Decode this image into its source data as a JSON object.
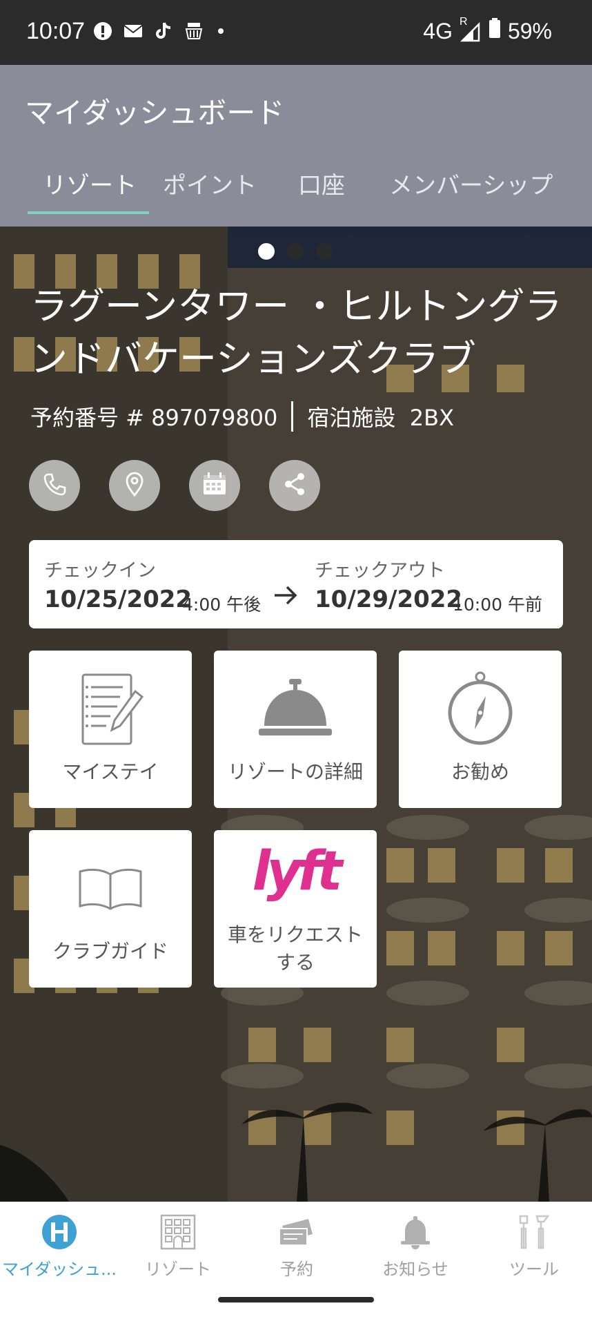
{
  "status_bar": {
    "time": "10:07",
    "network": "4G",
    "roaming": "R",
    "battery": "59%"
  },
  "header": {
    "title": "マイダッシュボード",
    "tabs": [
      {
        "label": "リゾート",
        "active": true
      },
      {
        "label": "ポイント",
        "active": false
      },
      {
        "label": "口座",
        "active": false
      },
      {
        "label": "メンバーシップ",
        "active": false
      }
    ]
  },
  "hero": {
    "carousel_pages": 3,
    "carousel_active": 1,
    "resort_name": "ラグーンタワー ・ヒルトングランドバケーションズクラブ",
    "reservation_label": "予約番号 # 897079800",
    "unit_label": "宿泊施設  2BX",
    "actions": [
      "phone-icon",
      "location-pin-icon",
      "calendar-icon",
      "share-icon"
    ]
  },
  "stay": {
    "checkin_label": "チェックイン",
    "checkin_date": "10/25/2022",
    "checkin_time": "4:00 午後",
    "checkout_label": "チェックアウト",
    "checkout_date": "10/29/2022",
    "checkout_time": "10:00 午前"
  },
  "tiles": [
    {
      "label": "マイステイ",
      "icon": "notepad-icon"
    },
    {
      "label": "リゾートの詳細",
      "icon": "service-bell-icon"
    },
    {
      "label": "お勧め",
      "icon": "compass-icon"
    },
    {
      "label": "クラブガイド",
      "icon": "open-book-icon"
    },
    {
      "label": "車をリクエストする",
      "label_line1": "車をリクエスト",
      "label_line2": "する",
      "icon": "lyft-logo",
      "logo_text": "lyft"
    }
  ],
  "bottom_nav": [
    {
      "label": "マイダッシュ...",
      "icon": "hilton-h-icon",
      "active": true
    },
    {
      "label": "リゾート",
      "icon": "building-icon",
      "active": false
    },
    {
      "label": "予約",
      "icon": "ticket-icon",
      "active": false
    },
    {
      "label": "お知らせ",
      "icon": "bell-icon",
      "active": false
    },
    {
      "label": "ツール",
      "icon": "tools-icon",
      "active": false
    }
  ],
  "colors": {
    "header_bg": "#8b8c9a",
    "tab_indicator": "#7fd1c4",
    "active_nav": "#3ea0d3",
    "lyft_pink": "#e0308f"
  }
}
